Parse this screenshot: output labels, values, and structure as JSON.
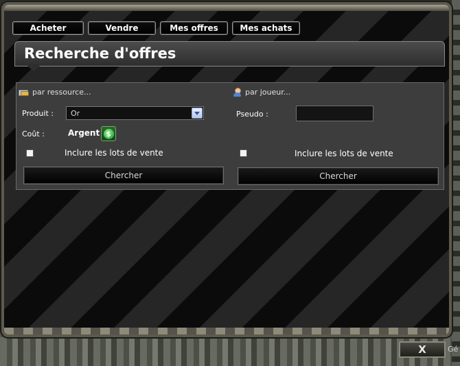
{
  "tabs": [
    {
      "label": "Acheter"
    },
    {
      "label": "Vendre"
    },
    {
      "label": "Mes offres"
    },
    {
      "label": "Mes achats"
    }
  ],
  "banner": {
    "title": "Recherche d'offres"
  },
  "by_resource": {
    "heading": "par ressource...",
    "product_label": "Produit :",
    "product_value": "Or",
    "cost_label": "Coût :",
    "currency": "Argent",
    "currency_icon_glyph": "$",
    "include_label": "Inclure les lots de vente",
    "include_checked": false,
    "search_button": "Chercher"
  },
  "by_player": {
    "heading": "par joueur...",
    "pseudo_label": "Pseudo :",
    "pseudo_value": "",
    "include_label": "Inclure les lots de vente",
    "include_checked": false,
    "search_button": "Chercher"
  },
  "footer": {
    "close_glyph": "X",
    "side_text": "Gé"
  }
}
